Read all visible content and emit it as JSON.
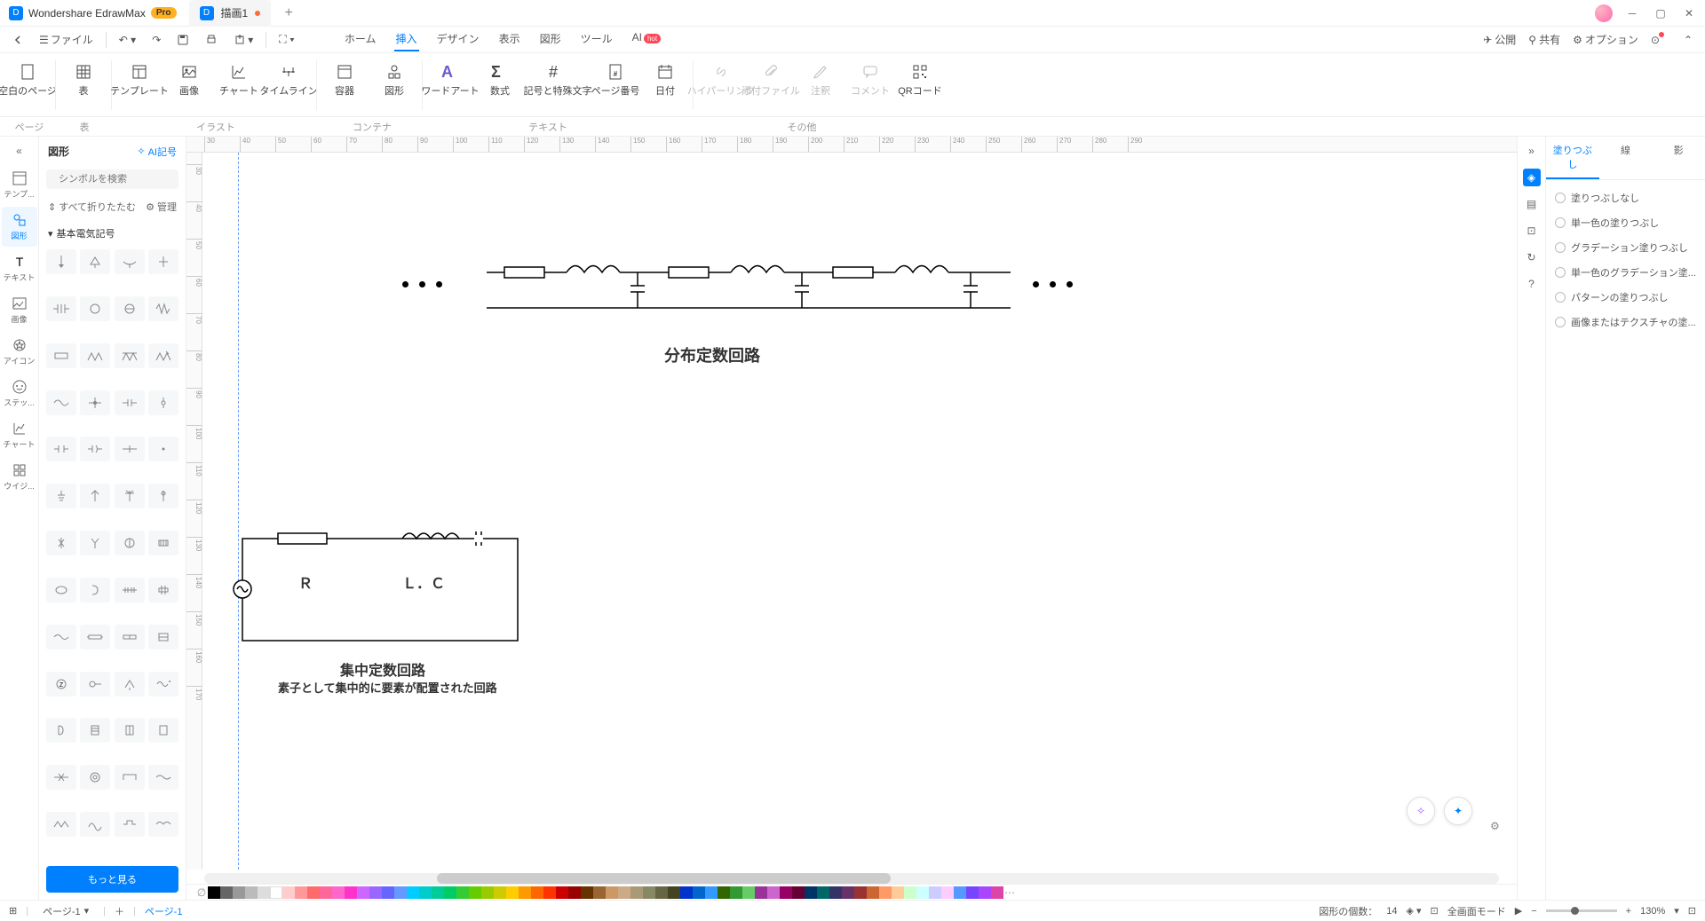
{
  "titlebar": {
    "app_name": "Wondershare EdrawMax",
    "pro_badge": "Pro",
    "doc_name": "描画1",
    "new_tab": "+"
  },
  "toolbar": {
    "back": "◀",
    "file": "ファイル",
    "menu_tabs": {
      "home": "ホーム",
      "insert": "挿入",
      "design": "デザイン",
      "view": "表示",
      "shape": "図形",
      "tool": "ツール",
      "ai": "AI"
    },
    "hot": "hot",
    "publish": "公開",
    "share": "共有",
    "options": "オプション"
  },
  "ribbon": {
    "blank_page": "空白のページ",
    "table": "表",
    "template": "テンプレート",
    "image": "画像",
    "chart": "チャート",
    "timeline": "タイムライン",
    "container": "容器",
    "diagram": "図形",
    "wordart": "ワードアート",
    "formula": "数式",
    "symbols": "記号と特殊文字",
    "pagenum": "ページ番号",
    "date": "日付",
    "hyperlink": "ハイパーリンク",
    "attachment": "添付ファイル",
    "annotation": "注釈",
    "comment": "コメント",
    "qrcode": "QRコード",
    "group_page": "ページ",
    "group_table": "表",
    "group_illust": "イラスト",
    "group_container": "コンテナ",
    "group_text": "テキスト",
    "group_other": "その他"
  },
  "rail": {
    "template": "テンプ...",
    "shapes": "図形",
    "text": "テキスト",
    "image": "画像",
    "icon": "アイコン",
    "sticker": "ステッ...",
    "chart": "チャート",
    "widget": "ウイジ..."
  },
  "shapes_panel": {
    "title": "図形",
    "ai_symbol": "AI記号",
    "search_placeholder": "シンボルを検索",
    "collapse_all": "すべて折りたたむ",
    "manage": "管理",
    "category": "基本電気記号",
    "more": "もっと見る"
  },
  "right_panel": {
    "collapse": "»",
    "tab_fill": "塗りつぶし",
    "tab_line": "線",
    "tab_shadow": "影",
    "opt_none": "塗りつぶしなし",
    "opt_solid": "単一色の塗りつぶし",
    "opt_gradient": "グラデーション塗りつぶし",
    "opt_gradient_solid": "単一色のグラデーション塗...",
    "opt_pattern": "パターンの塗りつぶし",
    "opt_texture": "画像またはテクスチャの塗..."
  },
  "canvas": {
    "title1": "分布定数回路",
    "label_R": "Ｒ",
    "label_LC": "Ｌ．Ｃ",
    "title2": "集中定数回路",
    "subtitle2": "素子として集中的に要素が配置された回路"
  },
  "colors": [
    "#000000",
    "#666666",
    "#999999",
    "#bbbbbb",
    "#dddddd",
    "#ffffff",
    "#ffcccc",
    "#ff9999",
    "#ff6b6b",
    "#ff6699",
    "#ff66cc",
    "#ff33cc",
    "#cc66ff",
    "#9966ff",
    "#6666ff",
    "#6699ff",
    "#00ccff",
    "#00cccc",
    "#00cc99",
    "#00cc66",
    "#33cc33",
    "#66cc00",
    "#99cc00",
    "#cccc00",
    "#ffcc00",
    "#ff9900",
    "#ff6600",
    "#ff3300",
    "#cc0000",
    "#990000",
    "#663300",
    "#996633",
    "#cc9966",
    "#ccaa88",
    "#aa9977",
    "#888866",
    "#666644",
    "#444422",
    "#0033cc",
    "#0066cc",
    "#3399ff",
    "#336600",
    "#339933",
    "#66cc66",
    "#993399",
    "#cc66cc",
    "#990066",
    "#660033",
    "#003366",
    "#006666",
    "#333366",
    "#663366",
    "#993333",
    "#cc6633",
    "#ff9966",
    "#ffcc99",
    "#ccffcc",
    "#ccffff",
    "#ccccff",
    "#ffccff",
    "#5599ff",
    "#7744ff",
    "#aa44ff",
    "#dd44aa"
  ],
  "statusbar": {
    "page_dropdown": "ページ-1",
    "page_link": "ページ-1",
    "shapes_count_label": "図形の個数：",
    "shapes_count": "14",
    "fullscreen": "全画面モード",
    "zoom": "130%"
  }
}
